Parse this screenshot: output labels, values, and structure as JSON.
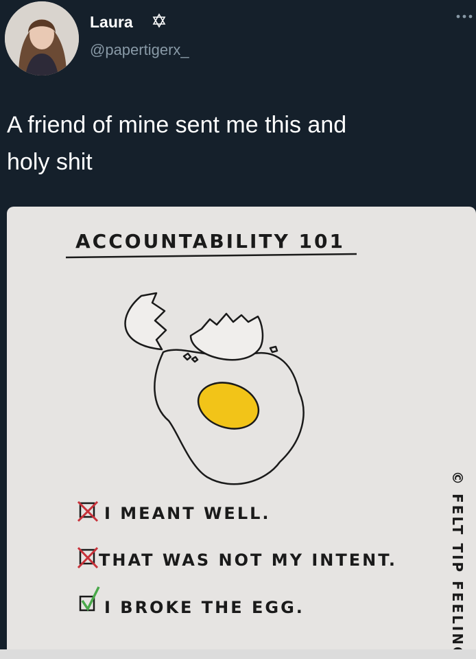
{
  "author": {
    "name": "Laura",
    "badge_icon": "star-of-david-icon",
    "handle": "@papertigerx_"
  },
  "header": {
    "more_icon": "more-options-icon"
  },
  "tweet": {
    "text": "A friend of mine sent me this and\nholy shit"
  },
  "comic": {
    "title": "Accountability 101",
    "items": [
      {
        "text": "I meant well.",
        "state": "crossed"
      },
      {
        "text": "That was not my intent.",
        "state": "crossed"
      },
      {
        "text": "I broke the egg.",
        "state": "checked"
      }
    ],
    "credit": "© Felt Tip Feelings",
    "colors": {
      "yolk": "#f2c418",
      "cross": "#c8323a",
      "check": "#49a84a"
    }
  },
  "theme": {
    "background": "#15202b",
    "handle": "#8899a6"
  }
}
